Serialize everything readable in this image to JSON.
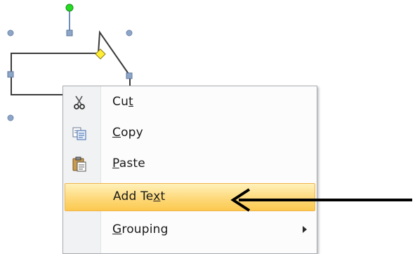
{
  "menu": {
    "items": [
      {
        "label": "Cut",
        "mnemonic": "t",
        "icon": "scissors-icon"
      },
      {
        "label": "Copy",
        "mnemonic": "C",
        "icon": "copy-icon"
      },
      {
        "label": "Paste",
        "mnemonic": "P",
        "icon": "clipboard-paste-icon"
      },
      {
        "label": "Add Text",
        "mnemonic": "x",
        "highlighted": true
      },
      {
        "label": "Grouping",
        "mnemonic": "G",
        "has_submenu": true
      }
    ]
  },
  "colors": {
    "highlight": "#fdd97a",
    "handle": "#7f95b7",
    "rotate_handle": "#22dd22",
    "adjust_handle": "#ffee33",
    "arrow": "#000000"
  }
}
